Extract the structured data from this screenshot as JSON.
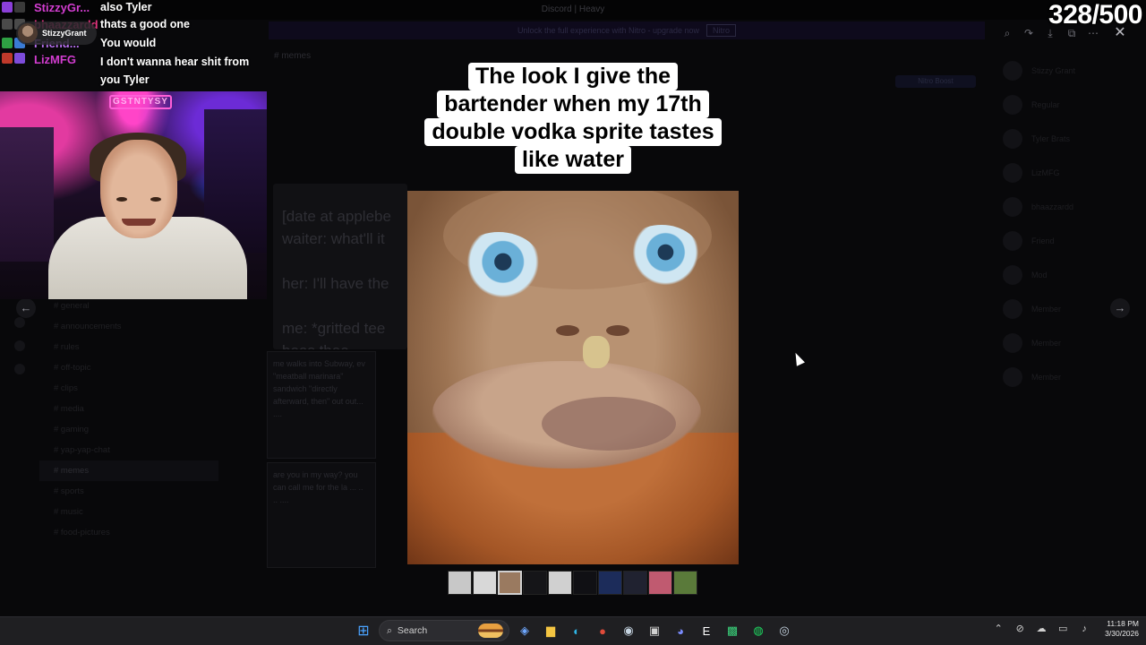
{
  "counter": "328/500",
  "stream_chat": [
    {
      "user": "StizzyGr...",
      "user_color": "#d23dd0",
      "message": "also Tyler",
      "badges": [
        "#8b3fd8",
        "#3a3a3a"
      ]
    },
    {
      "user": "bhaazzardd",
      "user_color": "#e0347c",
      "message": "thats a good one",
      "badges": [
        "#4a4a4a",
        "#4a4a4a"
      ]
    },
    {
      "user": "Friend...",
      "user_color": "#b870f0",
      "message": "You would",
      "badges": [
        "#2ea043",
        "#3a7bd5"
      ]
    },
    {
      "user": "LizMFG",
      "user_color": "#d23dd0",
      "message": "I don't wanna hear shit from you Tyler",
      "badges": [
        "#c0392b",
        "#7d4cdb"
      ]
    }
  ],
  "gift_popup": {
    "name": "StizzyGrant"
  },
  "webcam": {
    "sign_text": "GSTNTYSY"
  },
  "meme": {
    "caption_lines": [
      "The look I give the",
      "bartender when my 17th",
      "double vodka sprite tastes",
      "like water"
    ]
  },
  "background": {
    "window_title": "Discord | Heavy",
    "banner_text": "Unlock the full experience with Nitro - upgrade now",
    "banner_button": "Nitro",
    "channel_header": "# memes",
    "pill": "Nitro Boost",
    "card_text": [
      "[date at applebe",
      "waiter: what'll it",
      "",
      "her: I'll have the",
      "",
      "me: *gritted tee",
      "boos thee"
    ],
    "card2_text": "me walks into Subway, ev \"meatball marinara\" sandwich \"directly afterward, then\" out out... ....",
    "card3_text": "are you in my way? you can call me for the la ... .. .. ....",
    "channels": [
      "general",
      "announcements",
      "rules",
      "off-topic",
      "clips",
      "media",
      "gaming",
      "yap-yap-chat",
      "memes",
      "sports",
      "music",
      "food-pictures"
    ],
    "members": [
      "Stizzy Grant",
      "Regular",
      "Tyler Brats",
      "LizMFG",
      "bhaazzardd",
      "Friend",
      "Mod",
      "Member",
      "Member",
      "Member"
    ]
  },
  "viewer_tools": [
    "zoom-icon",
    "forward-icon",
    "download-icon",
    "open-icon",
    "more-icon"
  ],
  "thumbnails": [
    {
      "color": "#c8c8c8"
    },
    {
      "color": "#d8d8d8"
    },
    {
      "color": "#9a7a60"
    },
    {
      "color": "#151518"
    },
    {
      "color": "#d0d0d0"
    },
    {
      "color": "#101014"
    },
    {
      "color": "#1c2c5a"
    },
    {
      "color": "#202230"
    },
    {
      "color": "#c05a70"
    },
    {
      "color": "#5a7a3a"
    }
  ],
  "taskbar": {
    "search_placeholder": "Search",
    "time": "11:18 PM",
    "date": "3/30/2026",
    "apps": [
      {
        "name": "copilot-icon",
        "bg": "#2a2a2e",
        "glyph": "◈",
        "color": "#6fa8ff"
      },
      {
        "name": "file-explorer-icon",
        "bg": "#2a2a2e",
        "glyph": "▆",
        "color": "#f4c542"
      },
      {
        "name": "edge-icon",
        "bg": "#2a2a2e",
        "glyph": "◐",
        "color": "#2fb6e8"
      },
      {
        "name": "chrome-icon",
        "bg": "#2a2a2e",
        "glyph": "●",
        "color": "#e04b3a"
      },
      {
        "name": "steam-icon",
        "bg": "#2a2a2e",
        "glyph": "◉",
        "color": "#c5d3e0"
      },
      {
        "name": "store-icon",
        "bg": "#2a2a2e",
        "glyph": "▣",
        "color": "#d0d0d0"
      },
      {
        "name": "discord-icon",
        "bg": "#3a3a4e",
        "glyph": "◕",
        "color": "#7b8cff"
      },
      {
        "name": "epic-games-icon",
        "bg": "#2a2a2e",
        "glyph": "E",
        "color": "#ffffff"
      },
      {
        "name": "game-app-icon",
        "bg": "#2a2a2e",
        "glyph": "▩",
        "color": "#3ad07a"
      },
      {
        "name": "spotify-icon",
        "bg": "#2a2a2e",
        "glyph": "◍",
        "color": "#1ed760"
      },
      {
        "name": "steam-alt-icon",
        "bg": "#2a2a2e",
        "glyph": "◎",
        "color": "#c5d3e0"
      }
    ]
  }
}
